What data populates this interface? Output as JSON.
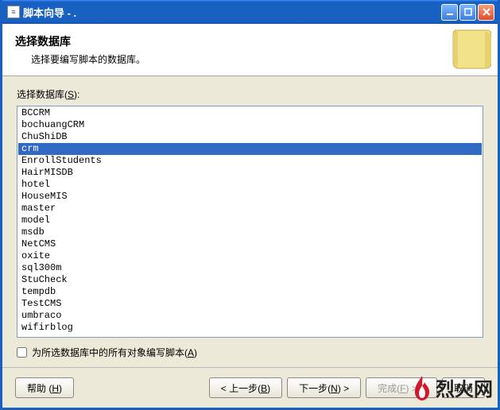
{
  "window": {
    "title": "脚本向导 - ."
  },
  "header": {
    "title": "选择数据库",
    "subtitle": "选择要编写脚本的数据库。"
  },
  "main": {
    "list_label_pre": "选择数据库(",
    "list_label_key": "S",
    "list_label_post": "):",
    "databases": [
      "BCCRM",
      "bochuangCRM",
      "ChuShiDB",
      "crm",
      "EnrollStudents",
      "HairMISDB",
      "hotel",
      "HouseMIS",
      "master",
      "model",
      "msdb",
      "NetCMS",
      "oxite",
      "sql300m",
      "StuCheck",
      "tempdb",
      "TestCMS",
      "umbraco",
      "wifirblog"
    ],
    "selected_index": 3,
    "checkbox_label_pre": "为所选数据库中的所有对象编写脚本(",
    "checkbox_label_key": "A",
    "checkbox_label_post": ")",
    "checkbox_checked": false
  },
  "footer": {
    "help_pre": "帮助 (",
    "help_key": "H",
    "help_post": ")",
    "back_pre": "< 上一步(",
    "back_key": "B",
    "back_post": ")",
    "next_pre": "下一步(",
    "next_key": "N",
    "next_post": ") >",
    "finish_pre": "完成(",
    "finish_key": "F",
    "finish_post": ") >>|",
    "cancel": "取消"
  },
  "watermark": {
    "text": "烈火网"
  }
}
